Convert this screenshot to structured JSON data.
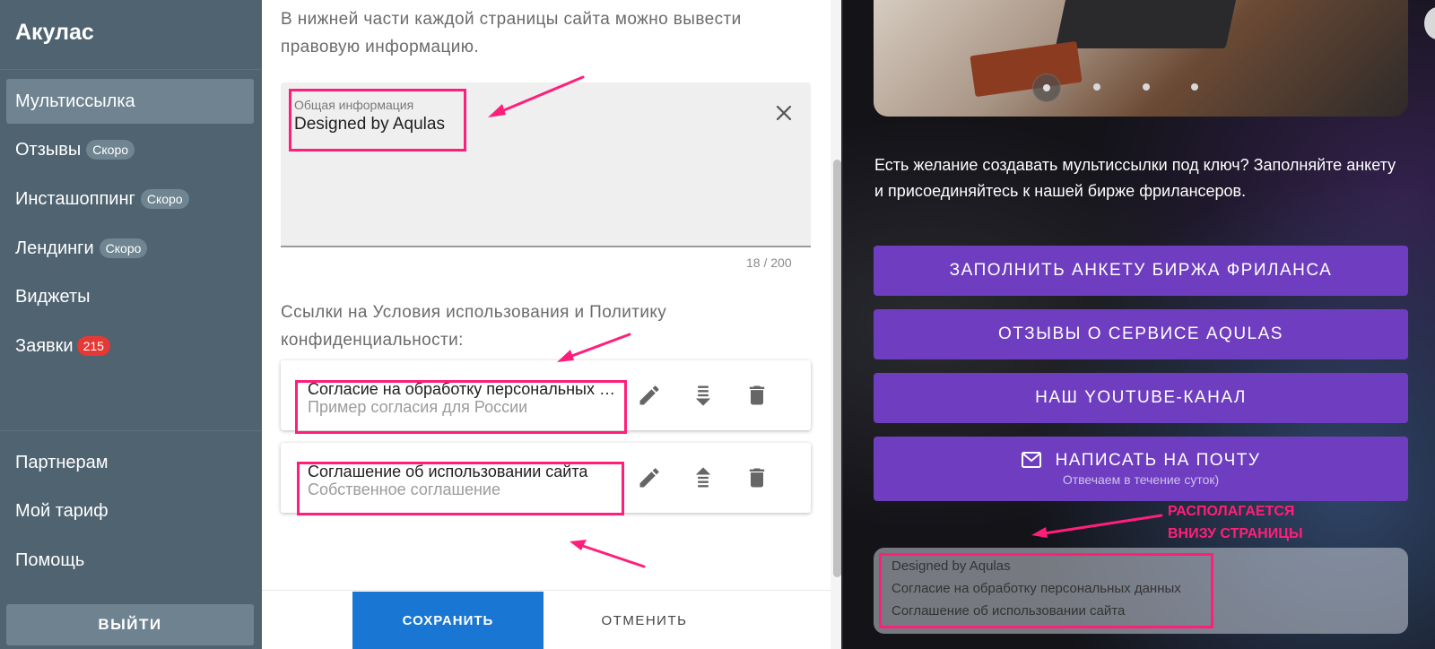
{
  "sidebar": {
    "brand": "Акулас",
    "items": [
      {
        "label": "Мультиссылка"
      },
      {
        "label": "Отзывы",
        "badge": "Скоро"
      },
      {
        "label": "Инсташоппинг",
        "badge": "Скоро"
      },
      {
        "label": "Лендинги",
        "badge": "Скоро"
      },
      {
        "label": "Виджеты"
      },
      {
        "label": "Заявки",
        "count": "215"
      }
    ],
    "bottom_items": [
      {
        "label": "Партнерам"
      },
      {
        "label": "Мой тариф"
      },
      {
        "label": "Помощь"
      }
    ],
    "logout_label": "ВЫЙТИ"
  },
  "panel": {
    "intro": "В нижней части каждой страницы сайта можно вывести правовую информацию.",
    "info_field": {
      "label": "Общая информация",
      "value": "Designed by Aqulas",
      "counter": "18 / 200"
    },
    "links_heading": "Ссылки на Условия использования и Политику конфиденциальности:",
    "links": [
      {
        "title": "Согласие на обработку персональных данных",
        "subtitle": "Пример согласия для России"
      },
      {
        "title": "Соглашение об использовании сайта",
        "subtitle": "Собственное соглашение"
      }
    ],
    "save_label": "СОХРАНИТЬ",
    "cancel_label": "ОТМЕНИТЬ"
  },
  "preview": {
    "promo_text": "Есть желание создавать мультиссылки под ключ? Заполняйте анкету и присоединяйтесь к нашей бирже фрилансеров.",
    "buttons": [
      {
        "label": "ЗАПОЛНИТЬ АНКЕТУ БИРЖА ФРИЛАНСА"
      },
      {
        "label": "ОТЗЫВЫ О СЕРВИСЕ AQULAS"
      },
      {
        "label": "НАШ YOUTUBE-КАНАЛ"
      }
    ],
    "mail_button": {
      "label": "НАПИСАТЬ НА ПОЧТУ",
      "sublabel": "Отвечаем в течение суток)"
    },
    "footer_lines": [
      "Designed by Aqulas",
      "Согласие на обработку персональных данных",
      "Соглашение об использовании сайта"
    ],
    "annotation": {
      "line1": "РАСПОЛАГАЕТСЯ",
      "line2": "ВНИЗУ СТРАНИЦЫ"
    }
  },
  "colors": {
    "sidebar": "#4f6370",
    "accent_blue": "#1976d2",
    "preview_button": "#6f3ec0",
    "annotation_pink": "#ff1f7a",
    "badge_red": "#e53935"
  },
  "icons": {
    "clear": "close-icon",
    "edit": "pencil-icon",
    "move_down": "move-down-icon",
    "move_up": "move-up-icon",
    "delete": "trash-icon",
    "mail": "mail-icon"
  }
}
